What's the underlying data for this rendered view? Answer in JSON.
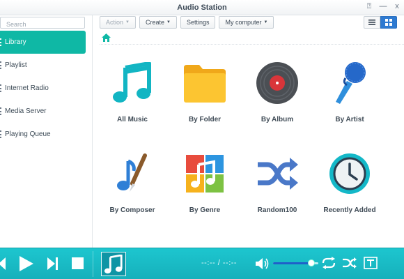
{
  "window": {
    "title": "Audio Station",
    "pin_glyph": "⍰",
    "minimize_glyph": "—",
    "close_glyph": "x"
  },
  "search": {
    "placeholder": "Search"
  },
  "sidebar": {
    "items": [
      {
        "label": "Library",
        "active": true
      },
      {
        "label": "Playlist",
        "active": false
      },
      {
        "label": "Internet Radio",
        "active": false
      },
      {
        "label": "Media Server",
        "active": false
      },
      {
        "label": "Playing Queue",
        "active": false
      }
    ]
  },
  "toolbar": {
    "action_label": "Action",
    "create_label": "Create",
    "settings_label": "Settings",
    "source_label": "My computer"
  },
  "view": {
    "mode": "grid"
  },
  "library": {
    "tiles": [
      {
        "label": "All Music",
        "icon": "music-note-icon"
      },
      {
        "label": "By Folder",
        "icon": "folder-icon"
      },
      {
        "label": "By Album",
        "icon": "vinyl-record-icon"
      },
      {
        "label": "By Artist",
        "icon": "microphone-icon"
      },
      {
        "label": "By Composer",
        "icon": "note-brush-icon"
      },
      {
        "label": "By Genre",
        "icon": "genre-blocks-icon"
      },
      {
        "label": "Random100",
        "icon": "shuffle-icon"
      },
      {
        "label": "Recently Added",
        "icon": "clock-icon"
      }
    ]
  },
  "player": {
    "time_display": "--:-- / --:--",
    "volume_fraction": 0.85
  },
  "colors": {
    "accent": "#0fb8a5",
    "player_bg": "#16b0bb",
    "view_toggle_active": "#2e7ad1"
  }
}
